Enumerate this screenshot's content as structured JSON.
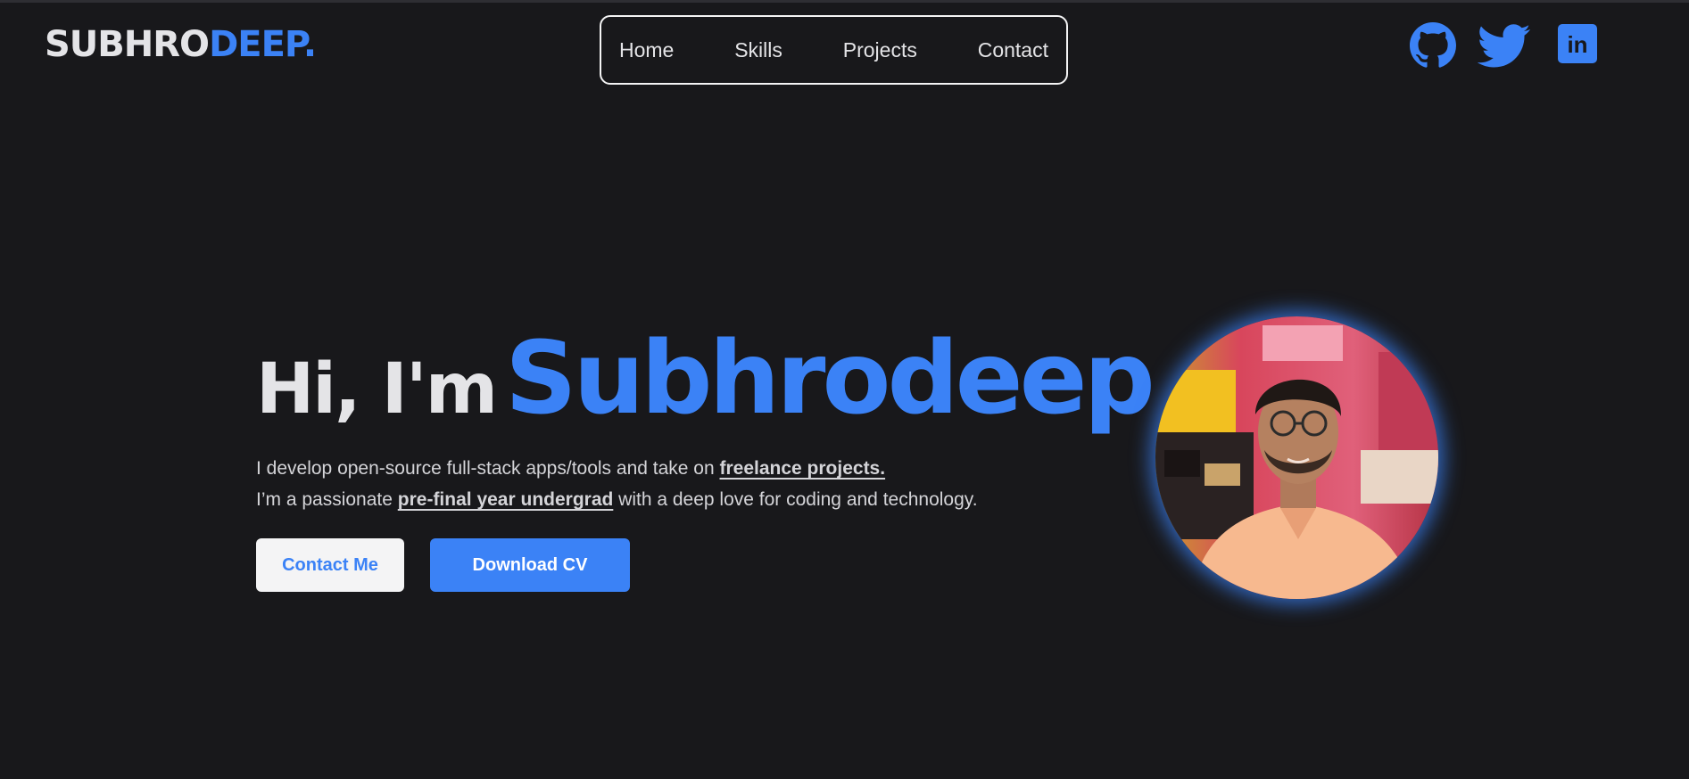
{
  "brand": {
    "first": "SUBHRO",
    "second": "DEEP."
  },
  "nav": {
    "home": "Home",
    "skills": "Skills",
    "projects": "Projects",
    "contact": "Contact"
  },
  "socials": {
    "icons": [
      "github-icon",
      "twitter-icon",
      "linkedin-icon"
    ],
    "color": "#3b82f6",
    "linkedin_glyph": "in"
  },
  "hero": {
    "greeting": "Hi, I'm",
    "name": "Subhrodeep",
    "line1_prefix": "I develop open-source full-stack apps/tools and take on ",
    "line1_emphasis": "freelance projects.",
    "line2_prefix": "I’m a passionate ",
    "line2_emphasis": "pre-final year undergrad",
    "line2_suffix": " with a deep love for coding and technology.",
    "contact_button": "Contact Me",
    "cv_button": "Download CV"
  },
  "colors": {
    "background": "#18181b",
    "accent": "#3b82f6",
    "text": "#d4d4d8",
    "heading": "#e4e4e7"
  }
}
